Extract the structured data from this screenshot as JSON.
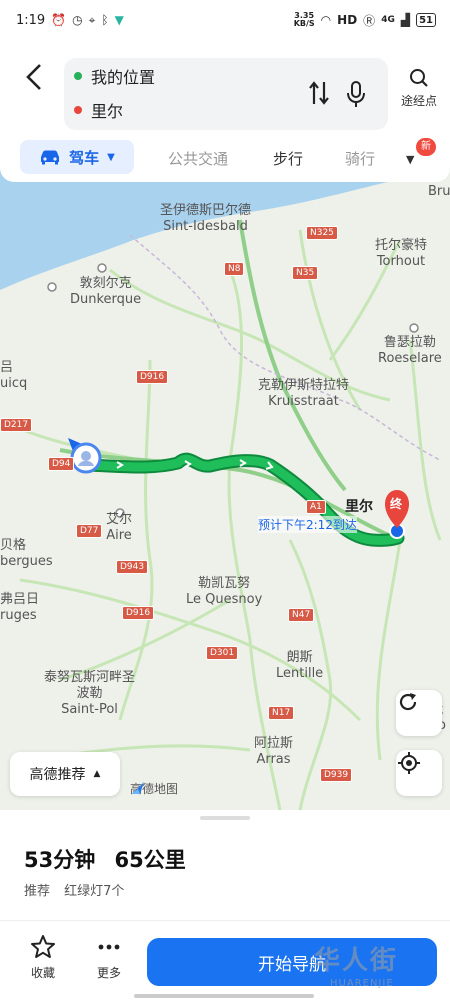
{
  "status_bar": {
    "time": "1:19",
    "speed_top": "3.35",
    "speed_bottom": "KB/S",
    "hd": "HD",
    "network": "4G",
    "battery": "51"
  },
  "header": {
    "from_label": "我的位置",
    "to_label": "里尔",
    "waypoint_label": "途经点",
    "colors": {
      "from_dot": "#27b05a",
      "to_dot": "#e8453c"
    }
  },
  "mode_tabs": {
    "drive": "驾车",
    "transit": "公共交通",
    "walk": "步行",
    "bike": "骑行",
    "badge": "新"
  },
  "map": {
    "labels": [
      {
        "id": "sint-idesbald",
        "text": "圣伊德斯巴尔德\nSint-Idesbald"
      },
      {
        "id": "dunkerque",
        "text": "敦刻尔克\nDunkerque"
      },
      {
        "id": "torhout",
        "text": "托尔豪特\nTorhout"
      },
      {
        "id": "roeselare",
        "text": "鲁瑟拉勒\nRoeselare"
      },
      {
        "id": "kruisstraat",
        "text": "克勒伊斯特拉特\nKruisstraat"
      },
      {
        "id": "aire",
        "text": "艾尔\nAire"
      },
      {
        "id": "bergues",
        "text": "贝格\nbergues"
      },
      {
        "id": "bruges",
        "text": "弗吕日\nruges"
      },
      {
        "id": "lequesnoy",
        "text": "勒凯瓦努\nLe Quesnoy"
      },
      {
        "id": "lentille",
        "text": "朗斯\nLentille"
      },
      {
        "id": "saintpol",
        "text": "泰努瓦斯河畔圣\n波勒\nSaint-Pol"
      },
      {
        "id": "arras",
        "text": "阿拉斯\nArras"
      },
      {
        "id": "calais",
        "text": "吕\nuicq"
      },
      {
        "id": "bru",
        "text": "Bru"
      },
      {
        "id": "rdo",
        "text": "杜\nDo"
      }
    ],
    "roads": [
      "N325",
      "N8",
      "N35",
      "D916",
      "D217",
      "D94",
      "D77",
      "D943",
      "D916",
      "N47",
      "D301",
      "N17",
      "D939",
      "A1"
    ],
    "destination_label": "里尔",
    "destination_pin": "终",
    "eta": "预计下午2:12到达",
    "recommend_label": "高德推荐",
    "logo_text": "高德地图",
    "colors": {
      "route": "#1fbe5b",
      "route_outline": "#0e8a3e",
      "sea": "#a9d2ef",
      "pin": "#e8453c"
    }
  },
  "sheet": {
    "duration": "53分钟",
    "distance": "65公里",
    "tag": "推荐",
    "traffic_lights": "红绿灯7个",
    "fav_label": "收藏",
    "more_label": "更多",
    "start_label": "开始导航",
    "watermark": "华人街",
    "watermark_sub": "HUARENJIE",
    "colors": {
      "start_button": "#1a73f0"
    }
  }
}
